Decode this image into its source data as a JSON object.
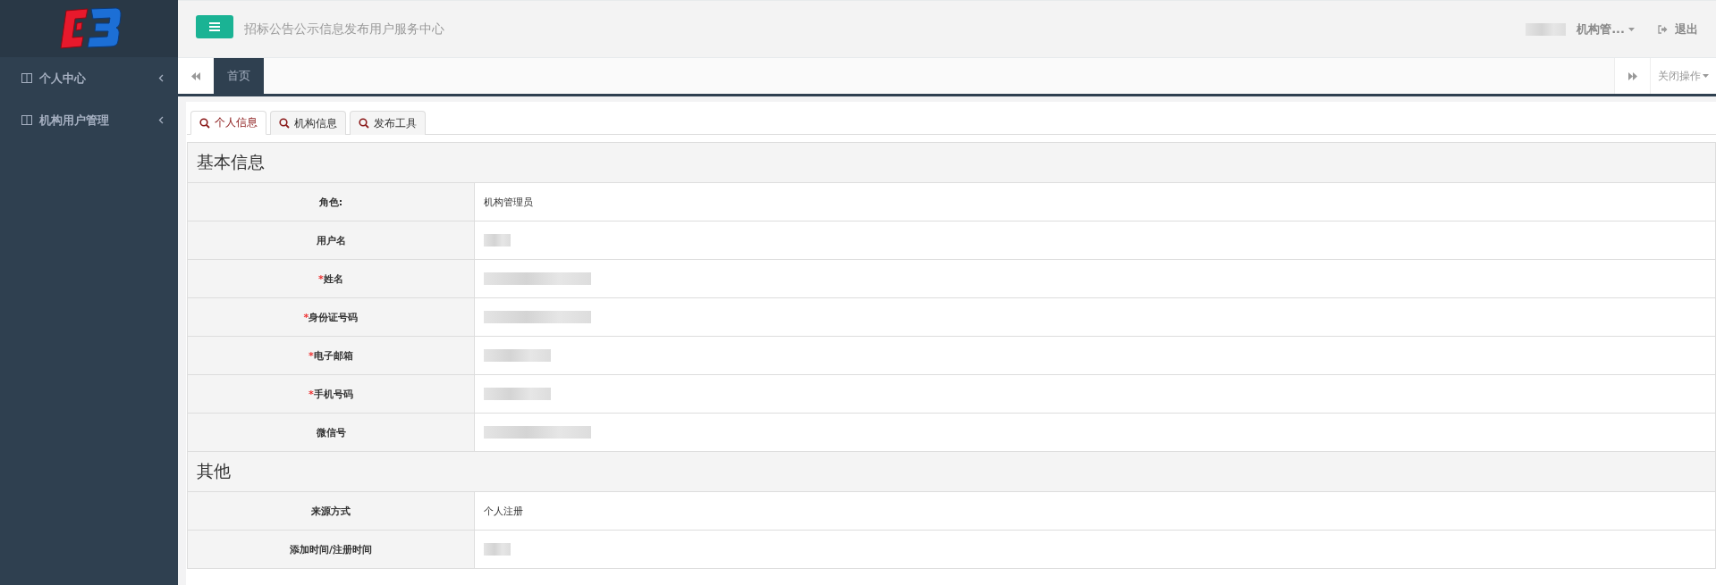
{
  "sidebar": {
    "items": [
      {
        "label": "个人中心",
        "expanded": false
      },
      {
        "label": "机构用户管理",
        "expanded": false
      }
    ]
  },
  "header": {
    "title": "招标公告公示信息发布用户服务中心",
    "user": {
      "name_redacted": true,
      "role": "机构管..."
    },
    "logout": "退出"
  },
  "page_tabs": {
    "tabs": [
      {
        "label": "首页",
        "selected": true
      }
    ],
    "close_menu": "关闭操作"
  },
  "content_tabs": [
    {
      "label": "个人信息",
      "selected": true
    },
    {
      "label": "机构信息",
      "selected": false
    },
    {
      "label": "发布工具",
      "selected": false
    }
  ],
  "sections": [
    {
      "title": "基本信息",
      "rows": [
        {
          "label": "角色:",
          "value": "机构管理员"
        },
        {
          "label": "用户名",
          "redacted": true
        },
        {
          "label": "姓名",
          "marker": "*",
          "redacted": true
        },
        {
          "label": "身份证号码",
          "marker": "*",
          "redacted": true
        },
        {
          "label": "电子邮箱",
          "marker": "*",
          "redacted": true
        },
        {
          "label": "手机号码",
          "marker": "*",
          "redacted": true
        },
        {
          "label": "微信号",
          "redacted": true
        }
      ]
    },
    {
      "title": "其他",
      "rows": [
        {
          "label": "来源方式",
          "value": "个人注册"
        },
        {
          "label": "添加时间/注册时间",
          "redacted": true
        }
      ]
    }
  ]
}
